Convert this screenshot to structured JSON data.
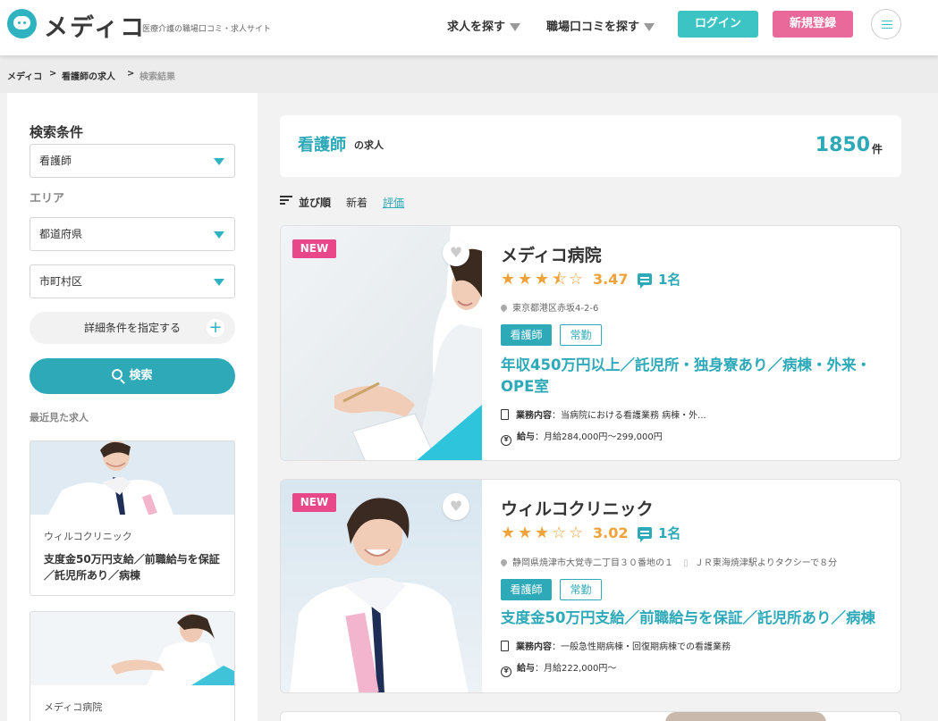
{
  "brand": {
    "logo_text": "メディコ",
    "tagline": "医療介護の職場口コミ・求人サイト",
    "accent": "#2fb3c1"
  },
  "nav": {
    "find_jobs": "求人を探す",
    "find_reviews": "職場口コミを探す",
    "login": "ログイン",
    "register": "新規登録"
  },
  "breadcrumb": [
    "メディコ",
    "看護師の求人",
    "検索結果"
  ],
  "sidebar": {
    "heading": "検索条件",
    "occupation_value": "看護師",
    "area_label": "エリア",
    "prefecture_placeholder": "都道府県",
    "city_placeholder": "市町村区",
    "detail_button": "詳細条件を指定する",
    "search_button": "検索",
    "recent_title": "最近見た求人",
    "recent": [
      {
        "name": "ウィルコクリニック",
        "desc": "支度金50万円支給／前職給与を保証／託児所あり／病棟"
      },
      {
        "name": "メディコ病院",
        "desc": ""
      }
    ]
  },
  "summary": {
    "occupation": "看護師",
    "suffix": "の求人",
    "count": "1850",
    "unit": "件"
  },
  "sort": {
    "label": "並び順",
    "options": [
      "新着",
      "評価"
    ],
    "active": "評価"
  },
  "jobs": [
    {
      "badge": "NEW",
      "title": "メディコ病院",
      "rating": 3.47,
      "rating_text": "3.47",
      "reviews": "1名",
      "address": "東京都港区赤坂4-2-6",
      "access": "",
      "tags": [
        "看護師",
        "常勤"
      ],
      "catch": "年収450万円以上／託児所・独身寮あり／病棟・外来・OPE室",
      "duty_label": "業務内容",
      "duty": "：当病院における看護業務 病棟・外...",
      "salary_label": "給与",
      "salary": "：月給284,000円〜299,000円"
    },
    {
      "badge": "NEW",
      "title": "ウィルコクリニック",
      "rating": 3.02,
      "rating_text": "3.02",
      "reviews": "1名",
      "address": "静岡県焼津市大覚寺二丁目３０番地の１",
      "access": "ＪＲ東海焼津駅よりタクシーで８分",
      "tags": [
        "看護師",
        "常勤"
      ],
      "catch": "支度金50万円支給／前職給与を保証／託児所あり／病棟",
      "duty_label": "業務内容",
      "duty": "：一般急性期病棟・回復期病棟での看護業務",
      "salary_label": "給与",
      "salary": "：月給222,000円〜"
    }
  ],
  "colors": {
    "teal": "#2da9b8",
    "pink": "#e96a9a",
    "new_badge": "#e8478a",
    "star": "#f0a23b"
  }
}
